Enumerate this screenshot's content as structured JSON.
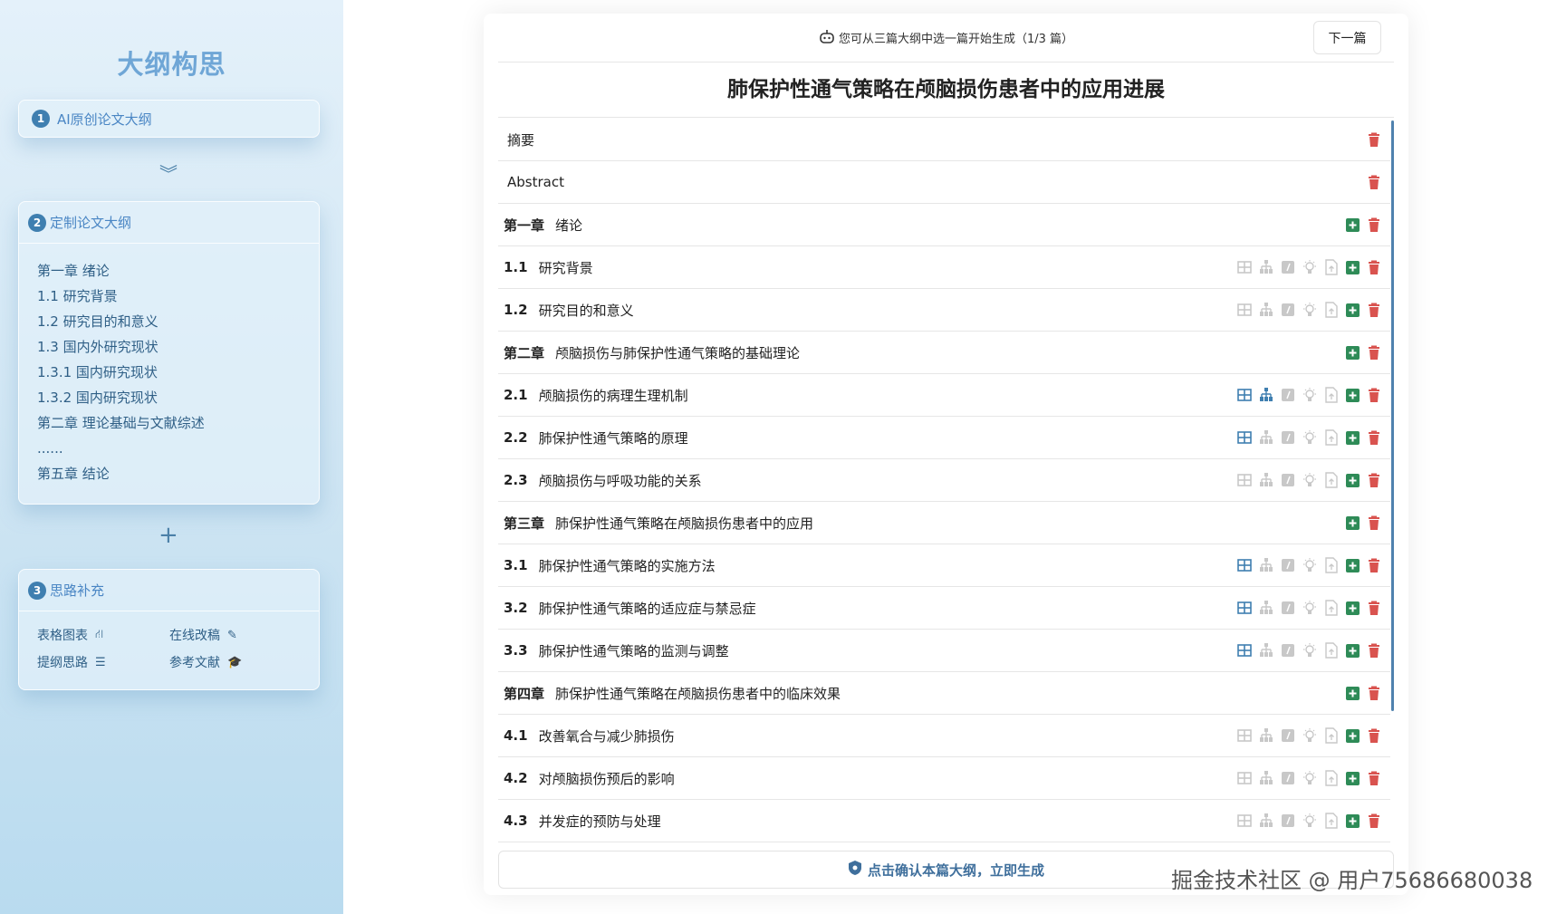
{
  "sidebar": {
    "title": "大纲构思",
    "step1": {
      "num": "1",
      "label": "AI原创论文大纲"
    },
    "step2": {
      "num": "2",
      "label": "定制论文大纲",
      "items": [
        "第一章 绪论",
        "1.1 研究背景",
        "1.2 研究目的和意义",
        "1.3 国内外研究现状",
        "1.3.1 国内研究现状",
        "1.3.2 国内研究现状",
        "第二章 理论基础与文献综述",
        "......",
        "第五章 结论"
      ]
    },
    "step3": {
      "num": "3",
      "label": "思路补充",
      "tools": [
        {
          "label": "表格图表",
          "icon": "chart-icon"
        },
        {
          "label": "在线改稿",
          "icon": "edit-icon"
        },
        {
          "label": "提纲思路",
          "icon": "list-icon"
        },
        {
          "label": "参考文献",
          "icon": "graduation-cap-icon"
        }
      ]
    }
  },
  "panel": {
    "hint": "您可从三篇大纲中选一篇开始生成（1/3 篇）",
    "next_label": "下一篇",
    "title": "肺保护性通气策略在颅脑损伤患者中的应用进展",
    "confirm_label": "点击确认本篇大纲，立即生成",
    "rows": [
      {
        "type": "plain",
        "num": "",
        "title": "摘要"
      },
      {
        "type": "plain",
        "num": "",
        "title": "Abstract"
      },
      {
        "type": "chapter",
        "num": "第一章",
        "title": "绪论"
      },
      {
        "type": "section",
        "num": "1.1",
        "title": "研究背景",
        "table_active": false,
        "tree_active": false
      },
      {
        "type": "section",
        "num": "1.2",
        "title": "研究目的和意义",
        "table_active": false,
        "tree_active": false
      },
      {
        "type": "chapter",
        "num": "第二章",
        "title": "颅脑损伤与肺保护性通气策略的基础理论"
      },
      {
        "type": "section",
        "num": "2.1",
        "title": "颅脑损伤的病理生理机制",
        "table_active": true,
        "tree_active": true
      },
      {
        "type": "section",
        "num": "2.2",
        "title": "肺保护性通气策略的原理",
        "table_active": true,
        "tree_active": false
      },
      {
        "type": "section",
        "num": "2.3",
        "title": "颅脑损伤与呼吸功能的关系",
        "table_active": false,
        "tree_active": false
      },
      {
        "type": "chapter",
        "num": "第三章",
        "title": "肺保护性通气策略在颅脑损伤患者中的应用"
      },
      {
        "type": "section",
        "num": "3.1",
        "title": "肺保护性通气策略的实施方法",
        "table_active": true,
        "tree_active": false
      },
      {
        "type": "section",
        "num": "3.2",
        "title": "肺保护性通气策略的适应症与禁忌症",
        "table_active": true,
        "tree_active": false
      },
      {
        "type": "section",
        "num": "3.3",
        "title": "肺保护性通气策略的监测与调整",
        "table_active": true,
        "tree_active": false
      },
      {
        "type": "chapter",
        "num": "第四章",
        "title": "肺保护性通气策略在颅脑损伤患者中的临床效果"
      },
      {
        "type": "section",
        "num": "4.1",
        "title": "改善氧合与减少肺损伤",
        "table_active": false,
        "tree_active": false
      },
      {
        "type": "section",
        "num": "4.2",
        "title": "对颅脑损伤预后的影响",
        "table_active": false,
        "tree_active": false
      },
      {
        "type": "section",
        "num": "4.3",
        "title": "并发症的预防与处理",
        "table_active": false,
        "tree_active": false
      }
    ]
  },
  "watermark": "掘金技术社区 @ 用户7568668003​8",
  "colors": {
    "accent": "#3f7fb0",
    "add": "#2e8b57",
    "delete": "#d9534f",
    "inactive_icon": "#c8c8c8",
    "active_icon": "#3f7fb0"
  }
}
